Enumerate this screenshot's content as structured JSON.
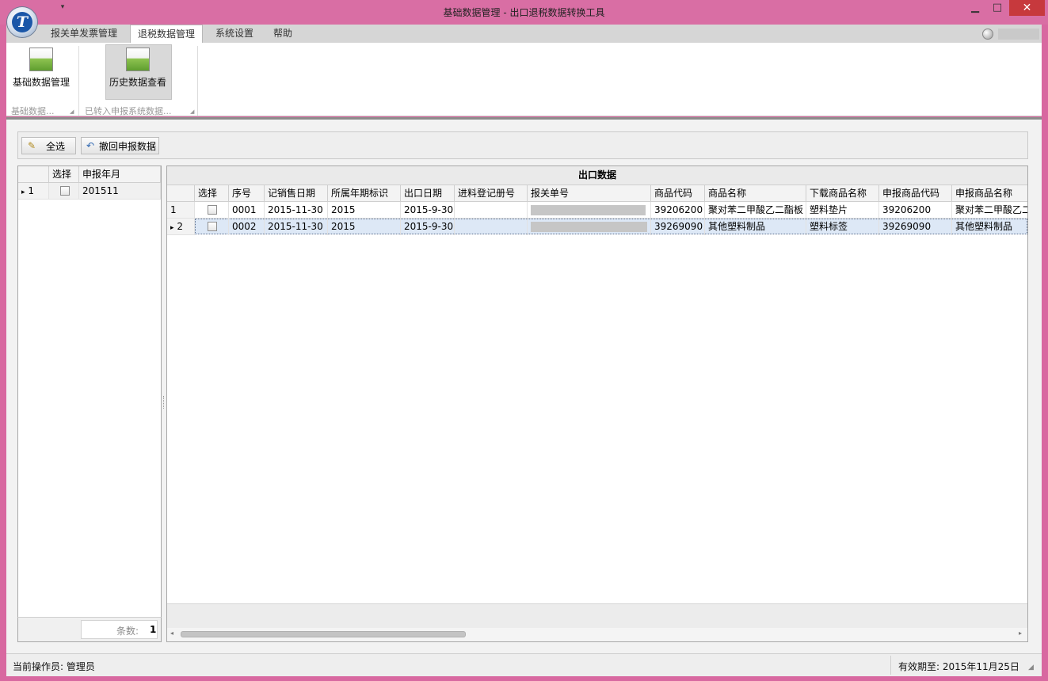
{
  "window": {
    "title": "基础数据管理 - 出口退税数据转换工具",
    "min_label": "▁",
    "max_label": "□",
    "close_label": "✕",
    "qat_label": "▾"
  },
  "tabs": [
    {
      "label": "报关单发票管理"
    },
    {
      "label": "退税数据管理"
    },
    {
      "label": "系统设置"
    },
    {
      "label": "帮助"
    }
  ],
  "ribbon": {
    "buttons": [
      {
        "label": "基础数据管理",
        "icon": "window-icon"
      },
      {
        "label": "历史数据查看",
        "icon": "window-icon"
      }
    ],
    "groups": [
      {
        "label": "基础数据..."
      },
      {
        "label": "已转入申报系统数据..."
      }
    ],
    "launcher": "◢"
  },
  "toolbar": {
    "select_all": "全选",
    "revoke": "撤回申报数据",
    "select_all_icon": "✎",
    "revoke_icon": "↶"
  },
  "left_grid": {
    "headers": {
      "select": "选择",
      "month": "申报年月"
    },
    "rows": [
      {
        "row_no": "1",
        "month": "201511"
      }
    ],
    "row_indicator": "▸",
    "count_label": "条数:",
    "count_value": "1"
  },
  "right_grid": {
    "caption": "出口数据",
    "row_indicator": "▸",
    "headers": [
      "选择",
      "序号",
      "记销售日期",
      "所属年期标识",
      "出口日期",
      "进料登记册号",
      "报关单号",
      "商品代码",
      "商品名称",
      "下载商品名称",
      "申报商品代码",
      "申报商品名称"
    ],
    "rows": [
      {
        "row_no": "1",
        "seq": "0001",
        "sale_date": "2015-11-30",
        "period": "2015",
        "export_date": "2015-9-30",
        "reg_no": "",
        "goods_code": "39206200",
        "goods_name": "聚对苯二甲酸乙二酯板",
        "dl_name": "塑料垫片",
        "decl_code": "39206200",
        "decl_name": "聚对苯二甲酸乙二"
      },
      {
        "row_no": "2",
        "seq": "0002",
        "sale_date": "2015-11-30",
        "period": "2015",
        "export_date": "2015-9-30",
        "reg_no": "",
        "goods_code": "39269090",
        "goods_name": "其他塑料制品",
        "dl_name": "塑料标签",
        "decl_code": "39269090",
        "decl_name": "其他塑料制品"
      }
    ],
    "scroll_left": "◂",
    "scroll_right": "▸"
  },
  "status": {
    "operator": "当前操作员: 管理员",
    "expiry": "有效期至: 2015年11月25日",
    "grip": "◢"
  },
  "colors": {
    "frame": "#d868a0",
    "close": "#c7393d",
    "selected_row": "#dde8f6"
  }
}
